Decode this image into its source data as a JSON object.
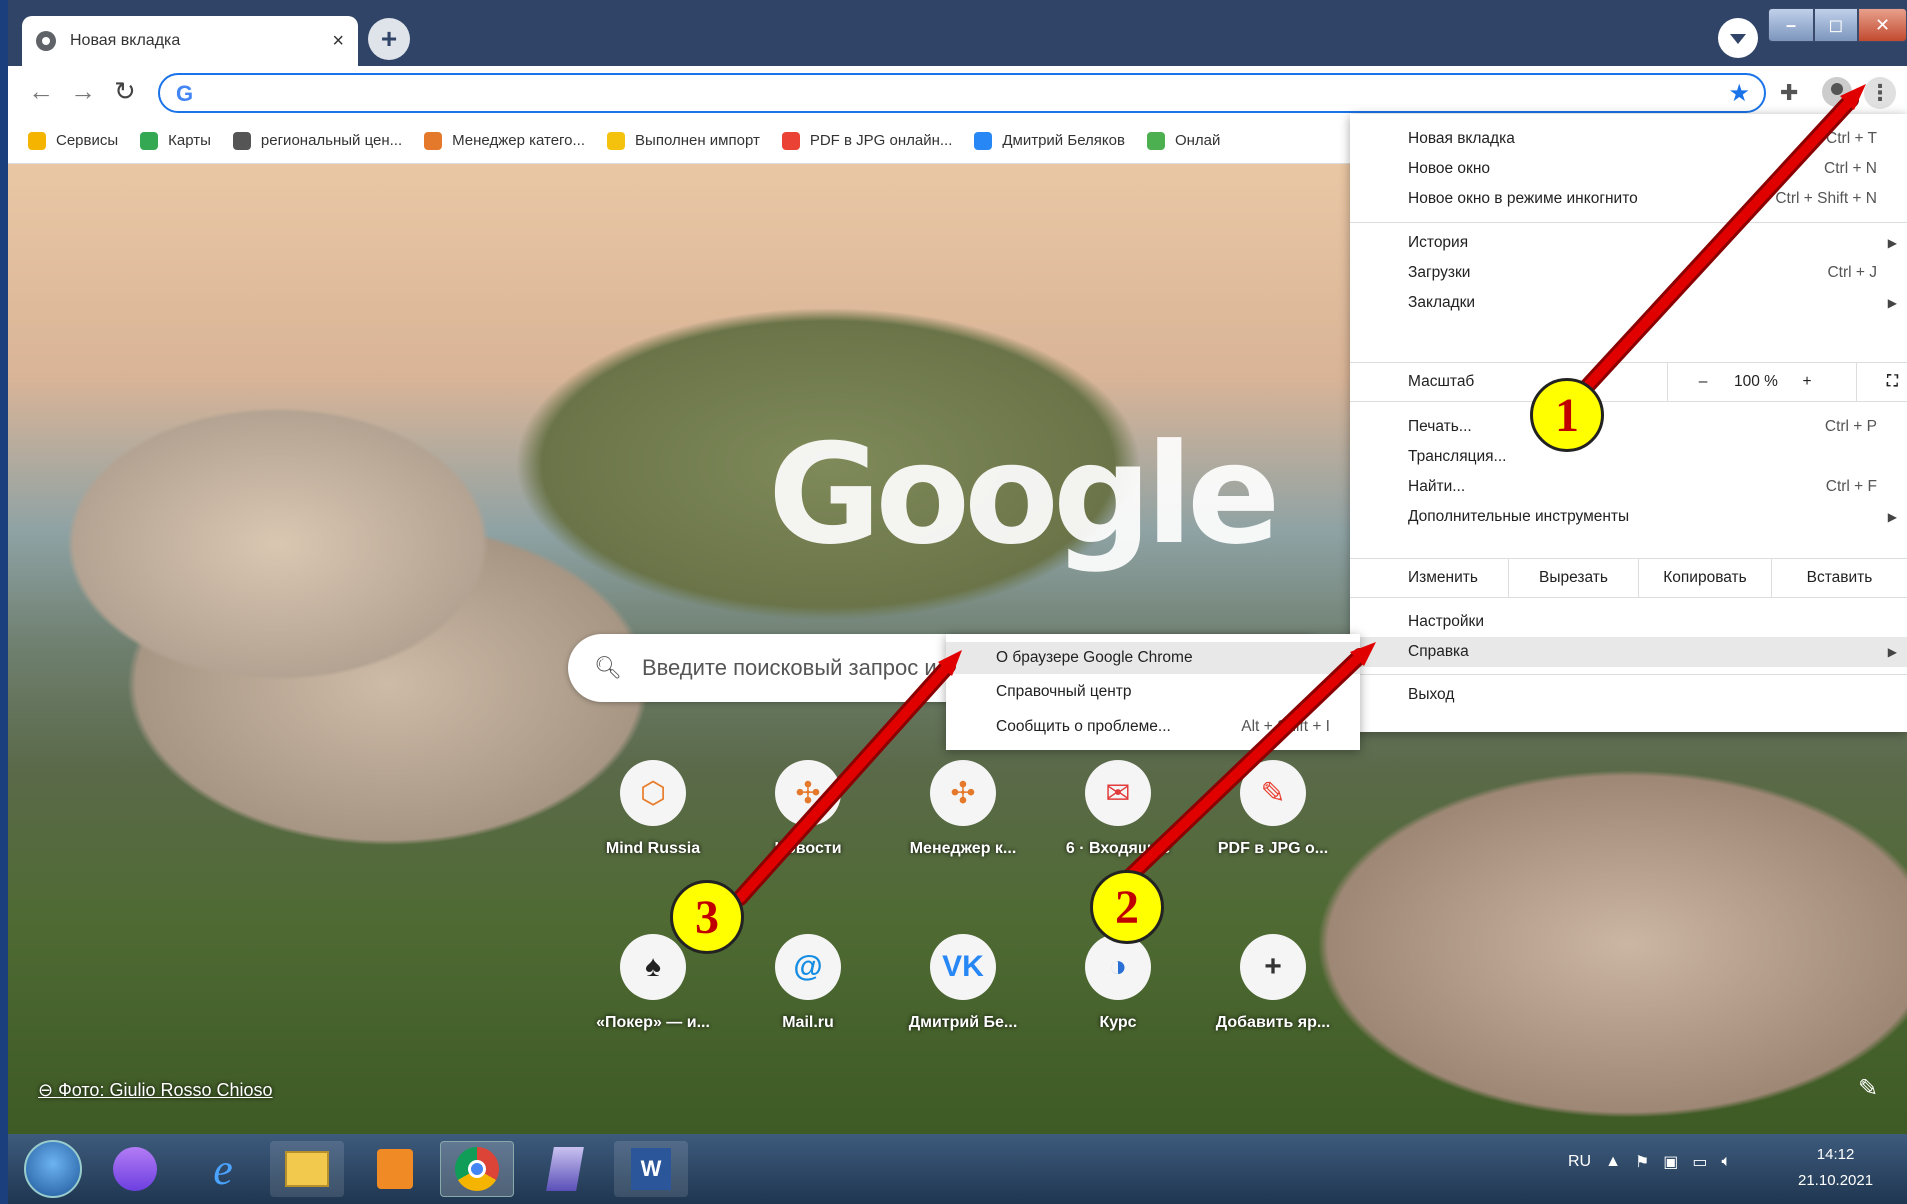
{
  "browser": {
    "tab_title": "Новая вкладка",
    "tab_close": "×",
    "new_tab": "+",
    "omnibox_g": "G"
  },
  "bookmarks": [
    {
      "label": "Сервисы",
      "color": "#f4b400"
    },
    {
      "label": "Карты",
      "color": "#34a853"
    },
    {
      "label": "региональный цен...",
      "color": "#555555"
    },
    {
      "label": "Менеджер катего...",
      "color": "#e5792b"
    },
    {
      "label": "Выполнен импорт",
      "color": "#f4c20d"
    },
    {
      "label": "PDF в JPG онлайн...",
      "color": "#ea4335"
    },
    {
      "label": "Дмитрий Беляков",
      "color": "#2787f5"
    },
    {
      "label": "Онлай",
      "color": "#4caf50"
    }
  ],
  "ntp": {
    "logo": "Google",
    "search_placeholder": "Введите поисковый запрос или URL",
    "shortcuts_row1": [
      {
        "label": "Mind Russia",
        "icon": "mind-russia-icon",
        "glyph": "⬡",
        "color": "#e87c2a"
      },
      {
        "label": "Новости",
        "icon": "joomla-icon",
        "glyph": "✣",
        "color": "#e5792b"
      },
      {
        "label": "Менеджер к...",
        "icon": "joomla-icon",
        "glyph": "✣",
        "color": "#e5792b"
      },
      {
        "label": "6 · Входящие",
        "icon": "mail-icon",
        "glyph": "✉",
        "color": "#e23b3b"
      },
      {
        "label": "PDF в JPG о...",
        "icon": "pdf-to-jpg-icon",
        "glyph": "✎",
        "color": "#ea4335"
      }
    ],
    "shortcuts_row2": [
      {
        "label": "«Покер» — и...",
        "icon": "poker-icon",
        "glyph": "♠",
        "color": "#222222"
      },
      {
        "label": "Mail.ru",
        "icon": "mailru-icon",
        "glyph": "@",
        "color": "#168de2"
      },
      {
        "label": "Дмитрий Бе...",
        "icon": "vk-icon",
        "glyph": "VK",
        "color": "#2787f5"
      },
      {
        "label": "Курс",
        "icon": "course-icon",
        "glyph": "◑",
        "color": "#2a6fd6"
      },
      {
        "label": "Добавить яр...",
        "icon": "plus-icon",
        "glyph": "+",
        "color": "#333333"
      }
    ],
    "photo_credit": "Фото: Giulio Rosso Chioso"
  },
  "menu": {
    "new_tab": "Новая вкладка",
    "new_tab_sc": "Ctrl + T",
    "new_window": "Новое окно",
    "new_window_sc": "Ctrl + N",
    "incognito": "Новое окно в режиме инкогнито",
    "incognito_sc": "Ctrl + Shift + N",
    "history": "История",
    "downloads": "Загрузки",
    "downloads_sc": "Ctrl + J",
    "bookmarks": "Закладки",
    "zoom_label": "Масштаб",
    "zoom_minus": "–",
    "zoom_value": "100 %",
    "zoom_plus": "+",
    "print": "Печать...",
    "print_sc": "Ctrl + P",
    "cast": "Трансляция...",
    "find": "Найти...",
    "find_sc": "Ctrl + F",
    "more_tools": "Дополнительные инструменты",
    "edit": "Изменить",
    "cut": "Вырезать",
    "copy": "Копировать",
    "paste": "Вставить",
    "settings": "Настройки",
    "help": "Справка",
    "exit": "Выход"
  },
  "submenu": {
    "about": "О браузере Google Chrome",
    "help_center": "Справочный центр",
    "report": "Сообщить о проблеме...",
    "report_sc": "Alt + Shift + I"
  },
  "annotations": [
    "1",
    "2",
    "3"
  ],
  "taskbar": {
    "lang": "RU",
    "time": "14:12",
    "date": "21.10.2021"
  },
  "colors": {
    "arrow": "#e00000",
    "badge_fill": "#ffff00",
    "badge_text": "#c00000"
  }
}
